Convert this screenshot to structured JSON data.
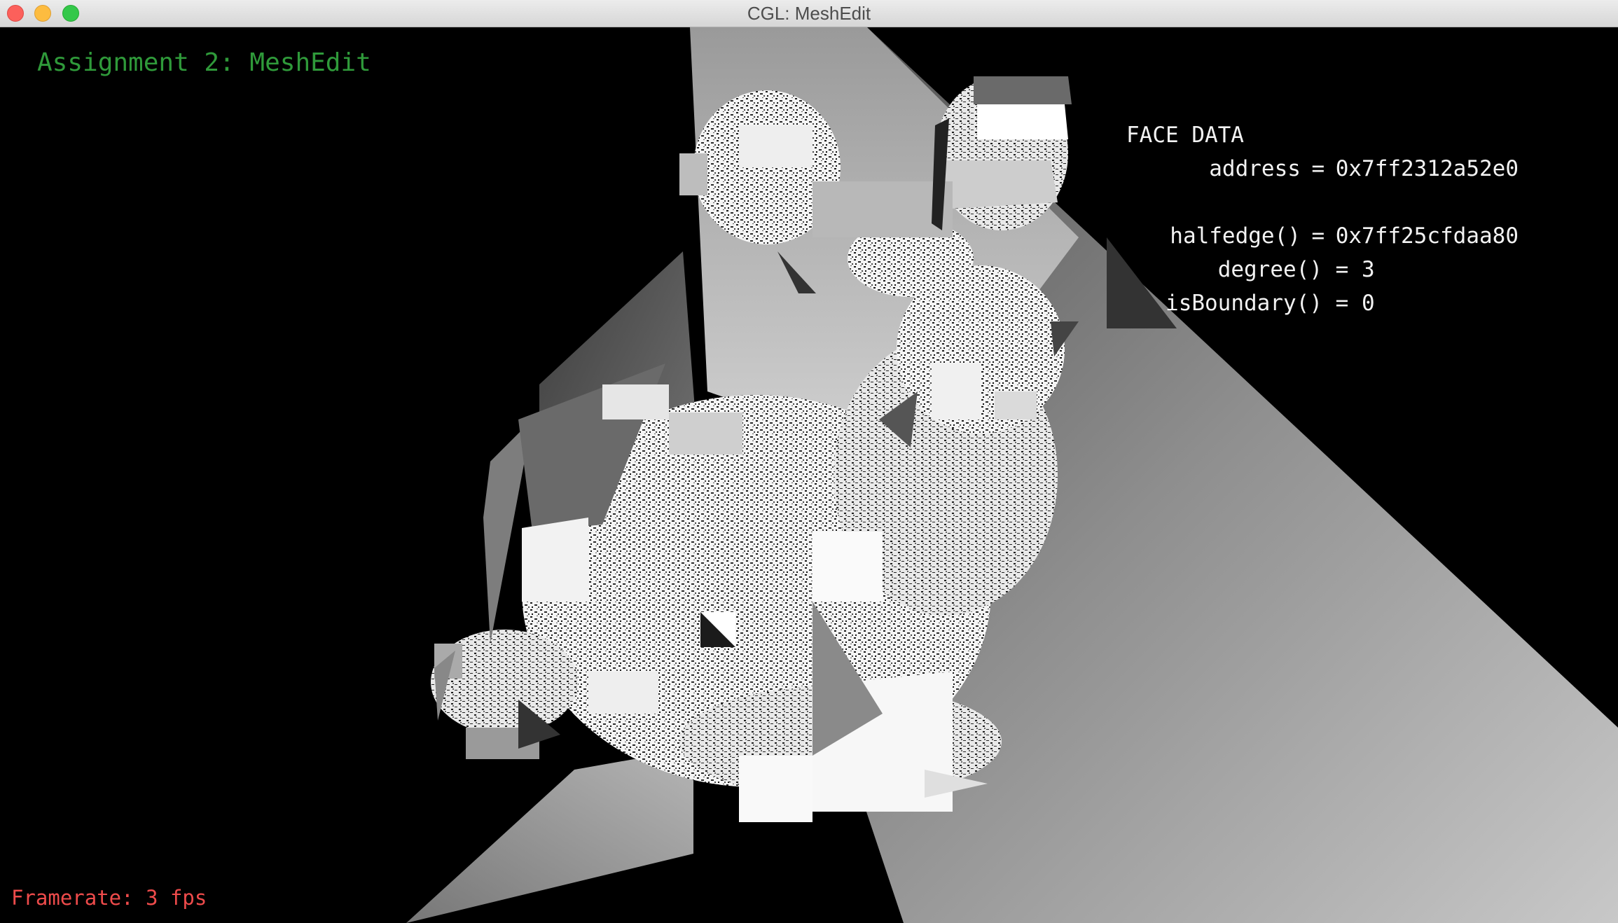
{
  "window": {
    "title": "CGL: MeshEdit"
  },
  "hud": {
    "assignment_title": "Assignment 2: MeshEdit",
    "framerate": "Framerate: 3 fps"
  },
  "face_data": {
    "heading": "FACE DATA",
    "address": {
      "key": "address",
      "value": "0x7ff2312a52e0"
    },
    "halfedge": {
      "key": "halfedge()",
      "value": "0x7ff25cfdaa80"
    },
    "degree": {
      "key": "degree()",
      "value": "3"
    },
    "is_boundary": {
      "key": "isBoundary()",
      "value": "0"
    }
  },
  "colors": {
    "title_green": "#2f9a3a",
    "framerate_red": "#ee4b4b",
    "info_text": "#f2f2f2",
    "background": "#000000"
  }
}
